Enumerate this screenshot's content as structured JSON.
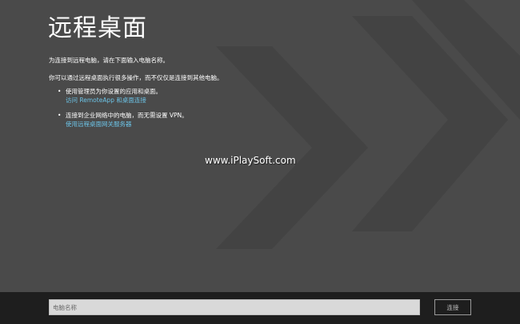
{
  "app": {
    "title": "远程桌面"
  },
  "content": {
    "intro": "为连接到远程电脑，请在下面输入电脑名称。",
    "description": "你可以通过远程桌面执行很多操作，而不仅仅是连接到其他电脑。",
    "bullets": [
      {
        "text": "使用管理员为你设置的应用和桌面。",
        "link": "访问 RemoteApp 和桌面连接"
      },
      {
        "text": "连接到企业网络中的电脑，而无需设置 VPN。",
        "link": "使用远程桌面网关服务器"
      }
    ]
  },
  "watermark": "www.iPlaySoft.com",
  "bottom_bar": {
    "input_placeholder": "电脑名称",
    "input_value": "",
    "connect_label": "连接"
  },
  "colors": {
    "background": "#4a4a4a",
    "chevron": "#434343",
    "bottom_bar": "#1e1e1e",
    "link": "#6cc3e6",
    "input_bg": "#d9d9d9"
  },
  "icons": {
    "background_graphic": "remote-desktop-chevrons"
  }
}
